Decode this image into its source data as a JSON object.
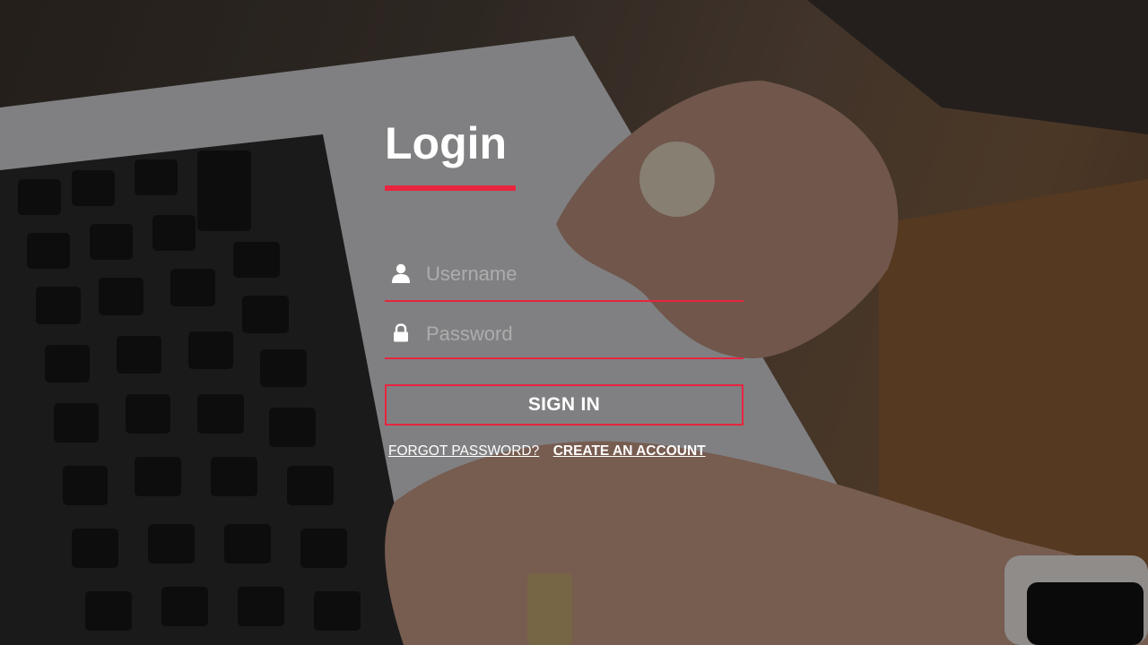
{
  "colors": {
    "accent": "#e8243f",
    "text": "#ffffff"
  },
  "login": {
    "title": "Login",
    "username": {
      "icon": "user-icon",
      "placeholder": "Username",
      "value": ""
    },
    "password": {
      "icon": "lock-icon",
      "placeholder": "Password",
      "value": ""
    },
    "sign_in_label": "SIGN IN",
    "forgot_password_label": "FORGOT PASSWORD?",
    "create_account_label": "CREATE AN ACCOUNT"
  }
}
